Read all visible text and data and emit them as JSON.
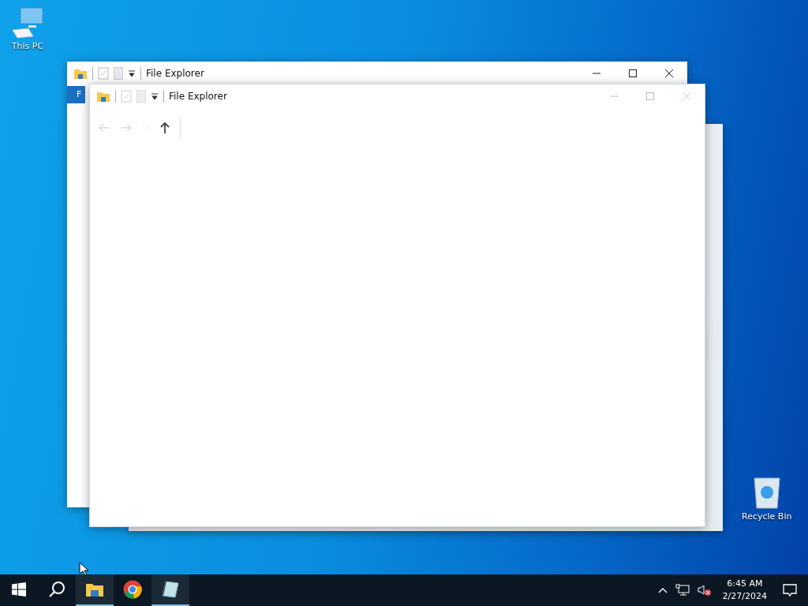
{
  "desktop_icons": [
    {
      "kind": "computer",
      "label": "This PC"
    },
    {
      "kind": "recycle",
      "label": "Recycle Bin"
    }
  ],
  "windows": [
    {
      "kind": "back",
      "title": "File Explorer",
      "ribbon_tab": "F"
    },
    {
      "kind": "front",
      "title": "File Explorer"
    }
  ],
  "taskbar": {
    "apps": [
      {
        "kind": "folder",
        "running": true
      },
      {
        "kind": "browser",
        "running": false
      },
      {
        "kind": "notepad",
        "running": true
      }
    ],
    "time": "6:45 AM",
    "date": "2/27/2024"
  }
}
